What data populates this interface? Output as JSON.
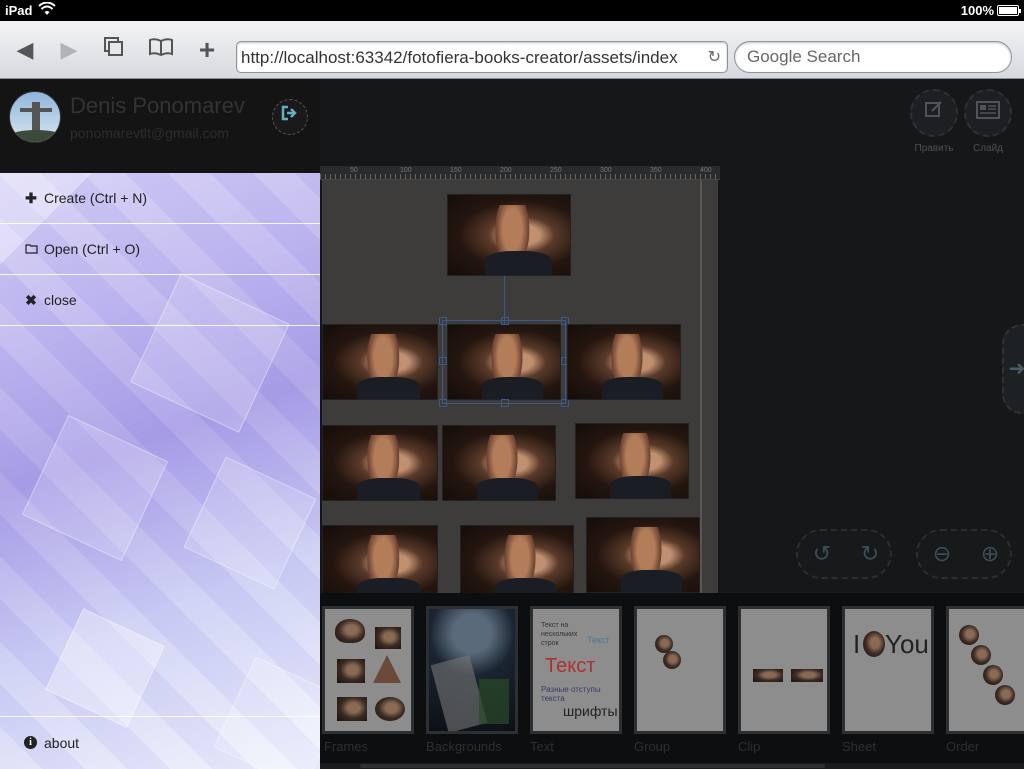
{
  "status_bar": {
    "device": "iPad",
    "battery": "100%"
  },
  "browser": {
    "url": "http://localhost:63342/fotofiera-books-creator/assets/index",
    "search_placeholder": "Google Search"
  },
  "user": {
    "name": "Denis Ponomarev",
    "email": "ponomarevtlt@gmail.com"
  },
  "menu": {
    "items": [
      {
        "label": "Create (Ctrl + N)",
        "icon": "plus-icon"
      },
      {
        "label": "Open (Ctrl + O)",
        "icon": "folder-icon"
      },
      {
        "label": "close",
        "icon": "close-icon"
      }
    ],
    "about": "about"
  },
  "top_actions": [
    {
      "label": "Править",
      "icon": "edit-icon"
    },
    {
      "label": "Слайд",
      "icon": "slide-icon"
    }
  ],
  "ruler_labels": [
    "50",
    "100",
    "150",
    "200",
    "250",
    "300",
    "350",
    "400"
  ],
  "thumbnails": [
    {
      "label": "Frames"
    },
    {
      "label": "Backgrounds"
    },
    {
      "label": "Text"
    },
    {
      "label": "Group"
    },
    {
      "label": "Clip"
    },
    {
      "label": "Sheet"
    },
    {
      "label": "Order"
    }
  ],
  "text_thumb": {
    "small": "Текст на нескольких строк",
    "colored": "Текст",
    "big": "Текст",
    "different": "Разные отступы текста",
    "fonts": "шрифты"
  },
  "sheet_thumb": {
    "i": "I",
    "you": "You"
  },
  "colors": {
    "menu_accent": "#b8b0ee",
    "logout_icon": "#65aebd"
  }
}
